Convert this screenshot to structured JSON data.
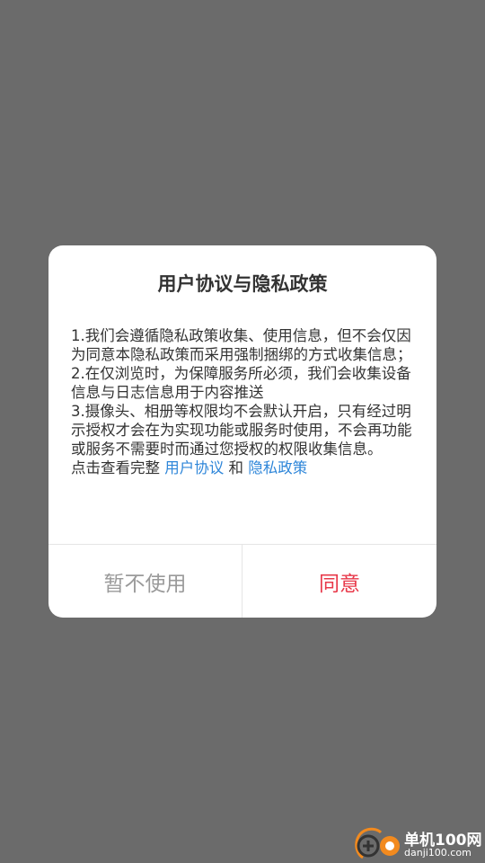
{
  "dialog": {
    "title": "用户协议与隐私政策",
    "paragraph1": "1.我们会遵循隐私政策收集、使用信息，但不会仅因为同意本隐私政策而采用强制捆绑的方式收集信息；",
    "paragraph2": "2.在仅浏览时，为保障服务所必须，我们会收集设备信息与日志信息用于内容推送",
    "paragraph3": "3.摄像头、相册等权限均不会默认开启，只有经过明示授权才会在为实现功能或服务时使用，不会再功能或服务不需要时而通过您授权的权限收集信息。",
    "view_prefix": "点击查看完整 ",
    "user_agreement_link": "用户协议",
    "and_text": " 和 ",
    "privacy_policy_link": "隐私政策",
    "decline_label": "暂不使用",
    "agree_label": "同意"
  },
  "watermark": {
    "name": "单机100网",
    "url": "danji100.com"
  },
  "colors": {
    "overlay": "#6b6b6b",
    "link": "#2e86d9",
    "agree": "#e8394a",
    "decline": "#9a9a9a"
  }
}
